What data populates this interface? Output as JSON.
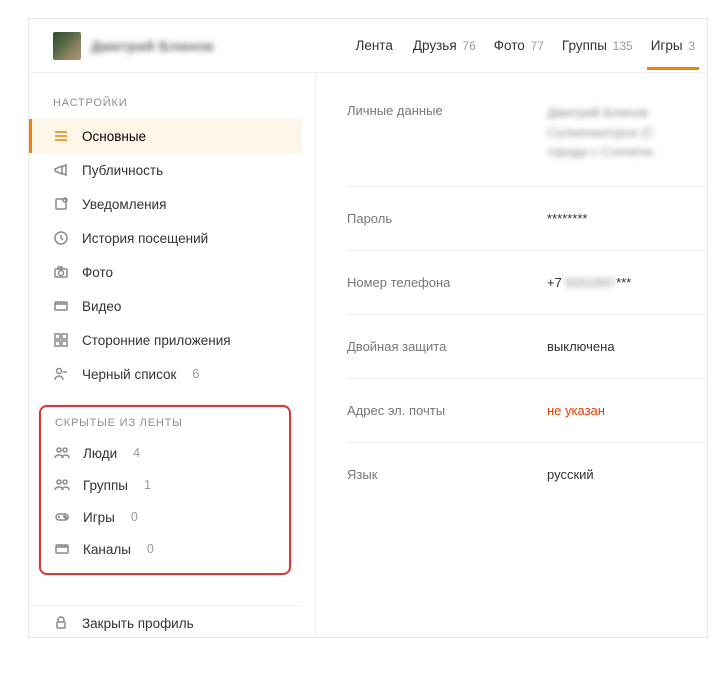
{
  "header": {
    "username": "Дмитрий Блинов",
    "nav": [
      {
        "label": "Лента",
        "count": ""
      },
      {
        "label": "Друзья",
        "count": "76"
      },
      {
        "label": "Фото",
        "count": "77"
      },
      {
        "label": "Группы",
        "count": "135"
      },
      {
        "label": "Игры",
        "count": "3"
      }
    ]
  },
  "sidebar": {
    "settings_title": "НАСТРОЙКИ",
    "items": [
      {
        "label": "Основные",
        "count": "",
        "icon": "menu"
      },
      {
        "label": "Публичность",
        "count": "",
        "icon": "megaphone"
      },
      {
        "label": "Уведомления",
        "count": "",
        "icon": "bell"
      },
      {
        "label": "История посещений",
        "count": "",
        "icon": "history"
      },
      {
        "label": "Фото",
        "count": "",
        "icon": "camera"
      },
      {
        "label": "Видео",
        "count": "",
        "icon": "video"
      },
      {
        "label": "Сторонние приложения",
        "count": "",
        "icon": "apps"
      },
      {
        "label": "Черный список",
        "count": "6",
        "icon": "blacklist"
      }
    ],
    "hidden_title": "СКРЫТЫЕ ИЗ ЛЕНТЫ",
    "hidden": [
      {
        "label": "Люди",
        "count": "4",
        "icon": "people"
      },
      {
        "label": "Группы",
        "count": "1",
        "icon": "people"
      },
      {
        "label": "Игры",
        "count": "0",
        "icon": "gamepad"
      },
      {
        "label": "Каналы",
        "count": "0",
        "icon": "video"
      }
    ],
    "close_profile": "Закрыть профиль"
  },
  "main": {
    "rows": [
      {
        "label": "Личные данные",
        "value_blur_lines": [
          "Дмитрий Блинов",
          "Солнечногорск (С",
          "города с Солнечн"
        ]
      },
      {
        "label": "Пароль",
        "value": "********"
      },
      {
        "label": "Номер телефона",
        "value_prefix": "+7 ",
        "value_blur": "9261897",
        "value_suffix": "***"
      },
      {
        "label": "Двойная защита",
        "value": "выключена"
      },
      {
        "label": "Адрес эл. почты",
        "value": "не указан",
        "red": true
      },
      {
        "label": "Язык",
        "value": "русский"
      }
    ]
  }
}
